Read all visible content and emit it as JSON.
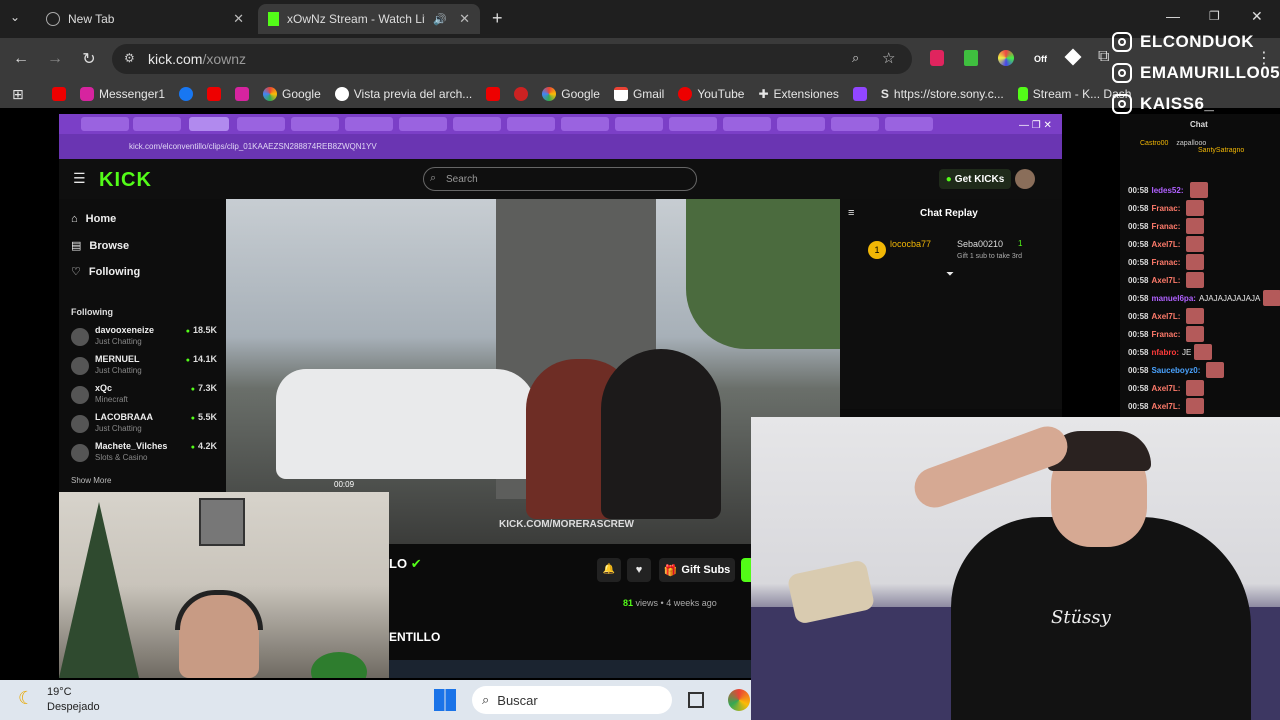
{
  "browser": {
    "tabs": [
      {
        "title": "New Tab"
      },
      {
        "title": "xOwNz Stream - Watch Live"
      }
    ],
    "url": {
      "domain": "kick.com",
      "path": "/xownz"
    },
    "bookmarks": [
      "Messenger1",
      "Google",
      "Vista previa del arch...",
      "Google",
      "Gmail",
      "YouTube",
      "Extensiones",
      "https://store.sony.c...",
      "Stream - K... Dash"
    ],
    "ext_off_label": "Off"
  },
  "socials": [
    "ELCONDUOK",
    "EMAMURILLO05",
    "KAISS6_"
  ],
  "inner": {
    "url": "kick.com/elconventillo/clips/clip_01KAAEZSN288874REB8ZWQN1YV",
    "search_placeholder": "Search",
    "get_kicks": "Get KICKs",
    "nav": [
      "Home",
      "Browse",
      "Following"
    ],
    "following_title": "Following",
    "following": [
      {
        "name": "davooxeneize",
        "sub": "Just Chatting",
        "count": "18.5K"
      },
      {
        "name": "MERNUEL",
        "sub": "Just Chatting",
        "count": "14.1K"
      },
      {
        "name": "xQc",
        "sub": "Minecraft",
        "count": "7.3K"
      },
      {
        "name": "LACOBRAAA",
        "sub": "Just Chatting",
        "count": "5.5K"
      },
      {
        "name": "Machete_Vilches",
        "sub": "Slots & Casino",
        "count": "4.2K"
      }
    ],
    "show_more": "Show More",
    "video_time": "00:09",
    "watermark": "KICK.COM/MORERASCREW",
    "channel_suffix": "LO",
    "channel_footer": "ENTILLO",
    "gift_subs": "Gift Subs",
    "views": "81",
    "views_label": "views",
    "ago": "4 weeks ago",
    "chat_replay_title": "Chat Replay",
    "gift_users": {
      "user1": "lococba77",
      "user2": "Seba00210",
      "count": "1",
      "msg": "Gift 1 sub to take 3rd"
    }
  },
  "stream_chat": {
    "title": "Chat",
    "top": {
      "u1": "Castro00",
      "u2": "zapallooo",
      "u3": "SantySatragno"
    },
    "lines": [
      {
        "t": "00:58",
        "u": "Iedes52:",
        "c": "#b061ff",
        "m": ""
      },
      {
        "t": "00:58",
        "u": "Franac:",
        "c": "#ff7b6b",
        "m": ""
      },
      {
        "t": "00:58",
        "u": "Franac:",
        "c": "#ff7b6b",
        "m": ""
      },
      {
        "t": "00:58",
        "u": "Axel7L:",
        "c": "#ff7b6b",
        "m": ""
      },
      {
        "t": "00:58",
        "u": "Franac:",
        "c": "#ff7b6b",
        "m": ""
      },
      {
        "t": "00:58",
        "u": "Axel7L:",
        "c": "#ff7b6b",
        "m": ""
      },
      {
        "t": "00:58",
        "u": "manuel6pa:",
        "c": "#b061ff",
        "m": "AJAJAJAJAJAJA"
      },
      {
        "t": "00:58",
        "u": "Axel7L:",
        "c": "#ff7b6b",
        "m": ""
      },
      {
        "t": "00:58",
        "u": "Franac:",
        "c": "#ff7b6b",
        "m": ""
      },
      {
        "t": "00:58",
        "u": "nfabro:",
        "c": "#ff3b3b",
        "m": "JE"
      },
      {
        "t": "00:58",
        "u": "Sauceboyz0:",
        "c": "#4aa3ff",
        "m": ""
      },
      {
        "t": "00:58",
        "u": "Axel7L:",
        "c": "#ff7b6b",
        "m": ""
      },
      {
        "t": "00:58",
        "u": "Axel7L:",
        "c": "#ff7b6b",
        "m": ""
      }
    ]
  },
  "taskbar": {
    "temp": "19°C",
    "weather": "Despejado",
    "search": "Buscar"
  }
}
